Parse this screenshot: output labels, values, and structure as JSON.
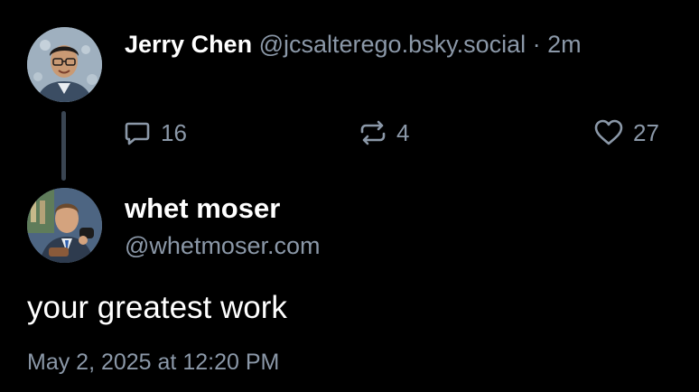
{
  "parent_post": {
    "author_name": "Jerry Chen",
    "handle": "@jcsalterego.bsky.social",
    "separator": " · ",
    "time_ago": "2m",
    "reply_count": "16",
    "repost_count": "4",
    "like_count": "27",
    "icons": {
      "reply": "comment-icon",
      "repost": "repost-icon",
      "like": "heart-icon"
    }
  },
  "focused_post": {
    "author_name": "whet moser",
    "handle": "@whetmoser.com",
    "text": "your greatest work",
    "timestamp": "May 2, 2025 at 12:20 PM"
  },
  "colors": {
    "background": "#000000",
    "primary_text": "#ffffff",
    "muted_text": "#8b98a8",
    "thread_line": "#3a4552"
  }
}
